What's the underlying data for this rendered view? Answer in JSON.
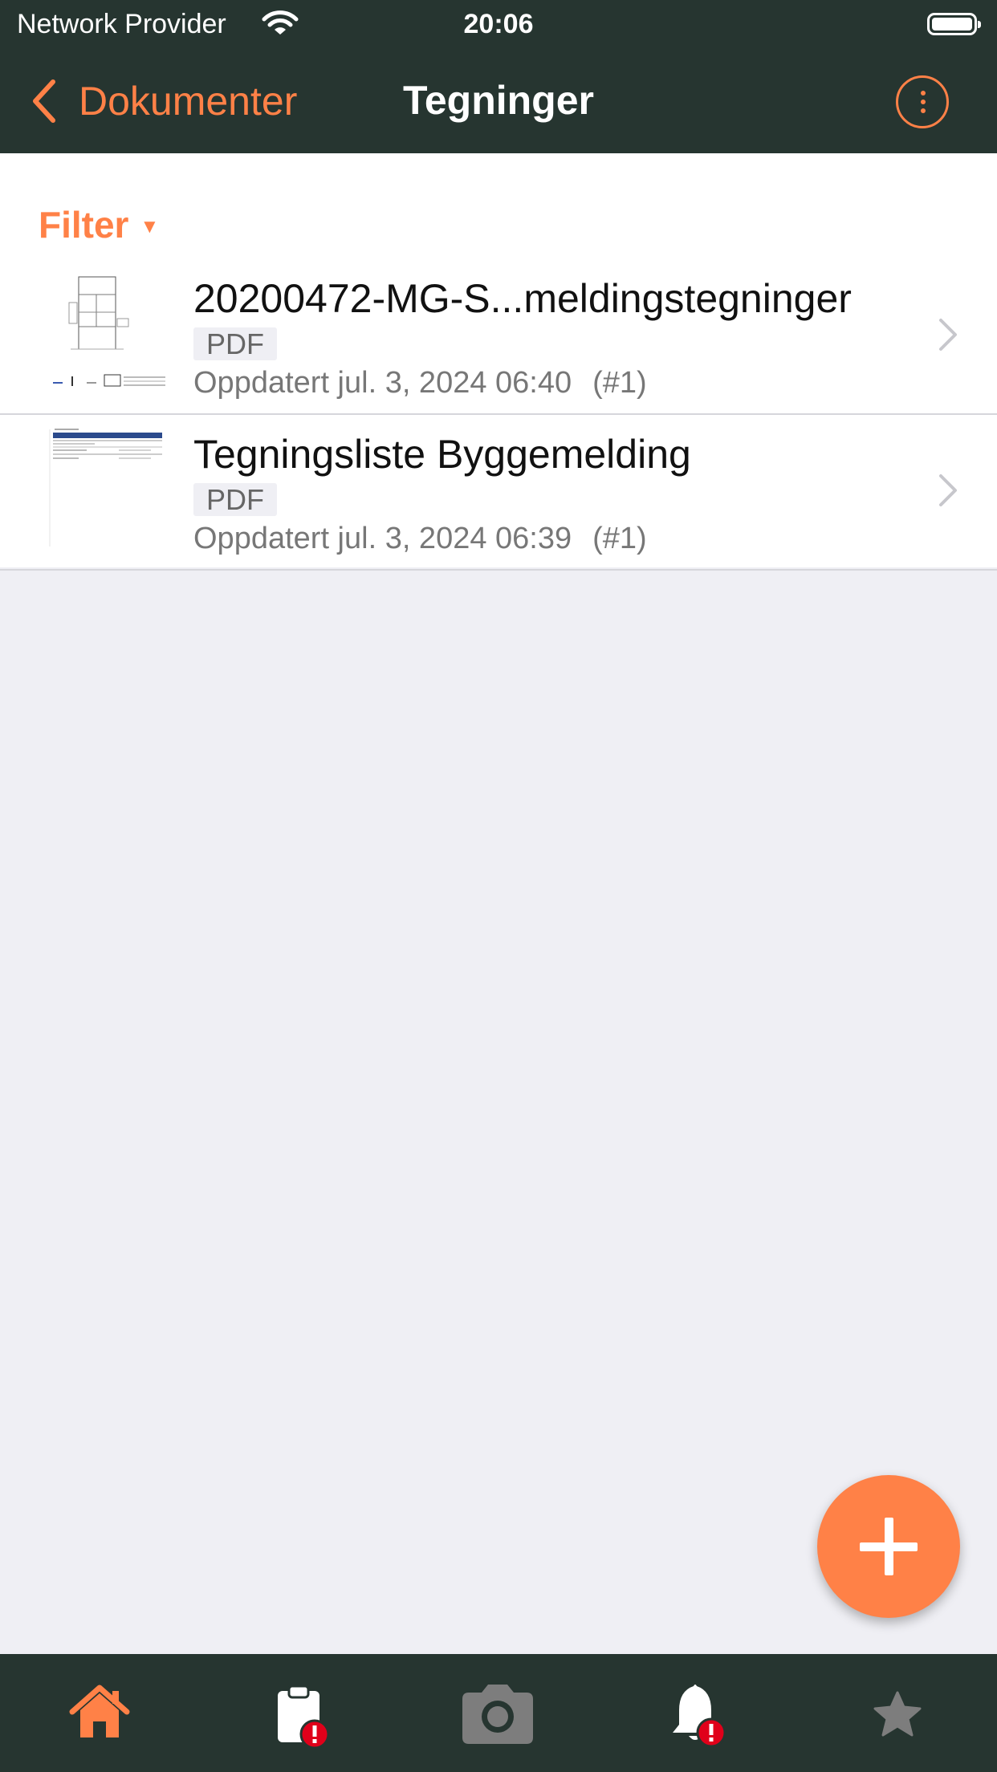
{
  "status_bar": {
    "provider": "Network Provider",
    "time": "20:06"
  },
  "nav": {
    "back_label": "Dokumenter",
    "title": "Tegninger"
  },
  "filter": {
    "label": "Filter"
  },
  "documents": [
    {
      "title": "20200472-MG-S...meldingstegninger",
      "type": "PDF",
      "updated": "Oppdatert jul. 3, 2024 06:40",
      "revision": "(#1)"
    },
    {
      "title": "Tegningsliste Byggemelding",
      "type": "PDF",
      "updated": "Oppdatert jul. 3, 2024 06:39",
      "revision": "(#1)"
    }
  ],
  "tabs": [
    {
      "icon": "home-icon",
      "active": true
    },
    {
      "icon": "clipboard-alert-icon",
      "active": false
    },
    {
      "icon": "camera-icon",
      "active": false
    },
    {
      "icon": "bell-alert-icon",
      "active": false
    },
    {
      "icon": "star-icon",
      "active": false
    }
  ],
  "colors": {
    "accent": "#ff8147",
    "header_bg": "#263530",
    "page_bg": "#efeff4",
    "alert": "#e0001a"
  }
}
